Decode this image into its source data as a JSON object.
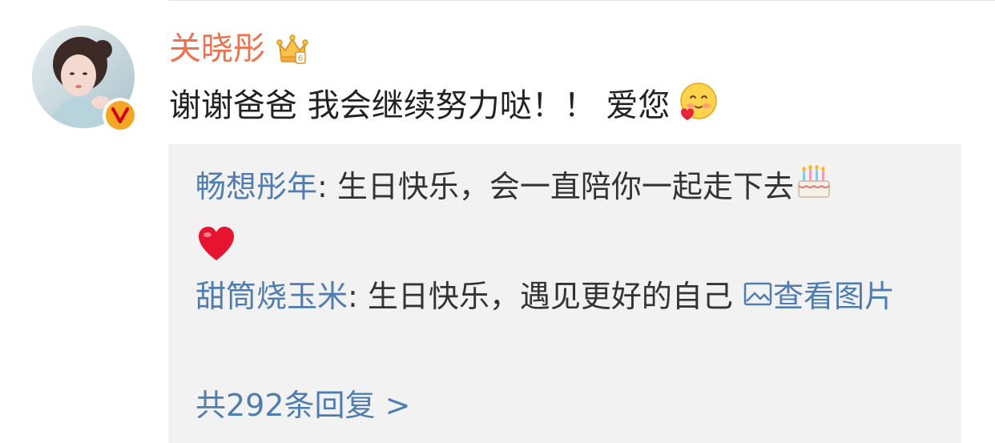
{
  "comment": {
    "username": "关晓彤",
    "text": "谢谢爸爸 我会继续努力哒！！ 爱您",
    "badge_letter": "V"
  },
  "replies": [
    {
      "author": "畅想彤年",
      "separator": ": ",
      "text": "生日快乐，会一直陪你一起走下去"
    },
    {
      "author": "甜筒烧玉米",
      "separator": ": ",
      "text": "生日快乐，遇见更好的自己 ",
      "link_text": "查看图片"
    }
  ],
  "more_replies": "共292条回复 >",
  "colors": {
    "username": "#eb7350",
    "link": "#507daf",
    "reply_bg": "#f2f2f2",
    "badge": "#f5a623"
  },
  "icons": {
    "crown": "crown-vip-icon",
    "blush": "blush-emoji-icon",
    "cake": "birthday-cake-icon",
    "heart": "red-heart-icon",
    "image": "image-icon"
  }
}
